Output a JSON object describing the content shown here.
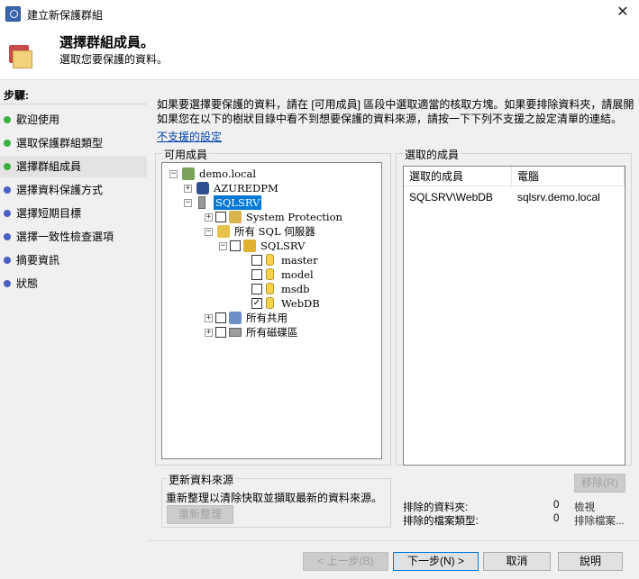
{
  "window": {
    "title": "建立新保護群組",
    "close_glyph": "✕"
  },
  "header": {
    "title": "選擇群組成員。",
    "subtitle": "選取您要保護的資料。"
  },
  "sidebar": {
    "title": "步驟:",
    "items": [
      {
        "label": "歡迎使用",
        "dot": "#3cb043"
      },
      {
        "label": "選取保護群組類型",
        "dot": "#3cb043"
      },
      {
        "label": "選擇群組成員",
        "dot": "#3cb043"
      },
      {
        "label": "選擇資料保護方式",
        "dot": "#4a5fc1"
      },
      {
        "label": "選擇短期目標",
        "dot": "#4a5fc1"
      },
      {
        "label": "選擇一致性檢查選項",
        "dot": "#4a5fc1"
      },
      {
        "label": "摘要資訊",
        "dot": "#4a5fc1"
      },
      {
        "label": "狀態",
        "dot": "#4a5fc1"
      }
    ]
  },
  "main": {
    "info_line1": "如果要選擇要保護的資料，請在 [可用成員] 區段中選取適當的核取方塊。如果要排除資料夾，請展開",
    "info_line2": "如果您在以下的樹狀目錄中看不到想要保護的資料來源，請按一下下列不支援之設定清單的連結。",
    "unsupported_link": "不支援的設定",
    "available": {
      "label": "可用成員",
      "tree": [
        {
          "label": "demo.local",
          "expander": "⊟",
          "icon": "domain",
          "checked": null
        },
        {
          "label": "AZUREDPM",
          "expander": "⊞",
          "icon": "dpm",
          "checked": null
        },
        {
          "label": "SQLSRV",
          "expander": "⊟",
          "icon": "server",
          "checked": null,
          "selected": true
        },
        {
          "label": "System Protection",
          "expander": "⊞",
          "icon": "sysprot",
          "checked": false
        },
        {
          "label": "所有 SQL 伺服器",
          "expander": "⊟",
          "icon": "sql",
          "checked": null
        },
        {
          "label": "SQLSRV",
          "expander": "⊟",
          "icon": "sqlinst",
          "checked": false
        },
        {
          "label": "master",
          "expander": null,
          "icon": "db",
          "checked": false
        },
        {
          "label": "model",
          "expander": null,
          "icon": "db",
          "checked": false
        },
        {
          "label": "msdb",
          "expander": null,
          "icon": "db",
          "checked": false
        },
        {
          "label": "WebDB",
          "expander": null,
          "icon": "db",
          "checked": true
        },
        {
          "label": "所有共用",
          "expander": "⊞",
          "icon": "share",
          "checked": false
        },
        {
          "label": "所有磁碟區",
          "expander": "⊞",
          "icon": "volume",
          "checked": false
        }
      ]
    },
    "refresh": {
      "label": "更新資料來源",
      "text": "重新整理以清除快取並擷取最新的資料來源。",
      "button": "重新整理"
    },
    "selected": {
      "label": "選取的成員",
      "columns": [
        "選取的成員",
        "電腦"
      ],
      "rows": [
        [
          "SQLSRV\\WebDB",
          "sqlsrv.demo.local"
        ]
      ],
      "remove_button": "移除(R)",
      "excluded_folders_label": "排除的資料夾:",
      "excluded_folders_count": "0",
      "excluded_folders_link": "檢視",
      "excluded_types_label": "排除的檔案類型:",
      "excluded_types_count": "0",
      "excluded_types_link": "排除檔案..."
    }
  },
  "footer": {
    "back": "< 上一步(B)",
    "next": "下一步(N) >",
    "cancel": "取消",
    "help": "說明"
  }
}
